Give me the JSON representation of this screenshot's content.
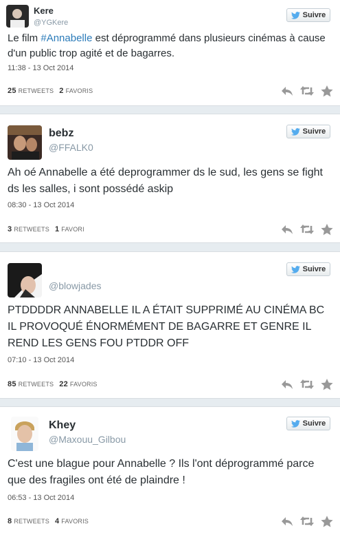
{
  "follow_label": "Suivre",
  "tweets": [
    {
      "name": "Kere",
      "handle": "@YGKere",
      "text_pre": "Le film ",
      "hashtag": "#Annabelle",
      "text_post": " est déprogrammé dans plusieurs cinémas à cause d'un public trop agité et de bagarres.",
      "time": "11:38 - 13 Oct 2014",
      "retweets": "25",
      "retweets_label": "RETWEETS",
      "favs": "2",
      "favs_label": "FAVORIS"
    },
    {
      "name": "bebz",
      "handle": "@FFALK0",
      "text": "Ah oé Annabelle a été deprogrammer ds le sud, les gens se fight ds les salles, i sont possédé askip",
      "time": "08:30 - 13 Oct 2014",
      "retweets": "3",
      "retweets_label": "RETWEETS",
      "favs": "1",
      "favs_label": "FAVORI"
    },
    {
      "name": "",
      "handle": "@blowjades",
      "text": "PTDDDDR ANNABELLE IL A ÉTAIT SUPPRIMÉ AU CINÉMA BC IL PROVOQUÉ ÉNORMÉMENT DE BAGARRE ET GENRE IL REND LES GENS FOU PTDDR OFF",
      "time": "07:10 - 13 Oct 2014",
      "retweets": "85",
      "retweets_label": "RETWEETS",
      "favs": "22",
      "favs_label": "FAVORIS"
    },
    {
      "name": "Khey",
      "handle": "@Maxouu_Gilbou",
      "text": "C'est une blague pour Annabelle ? Ils l'ont déprogrammé parce que des fragiles ont été de plaindre !",
      "time": "06:53 - 13 Oct 2014",
      "retweets": "8",
      "retweets_label": "RETWEETS",
      "favs": "4",
      "favs_label": "FAVORIS"
    }
  ],
  "colors": {
    "link": "#2b7bb9",
    "bird": "#55acee",
    "icon": "#999999"
  }
}
